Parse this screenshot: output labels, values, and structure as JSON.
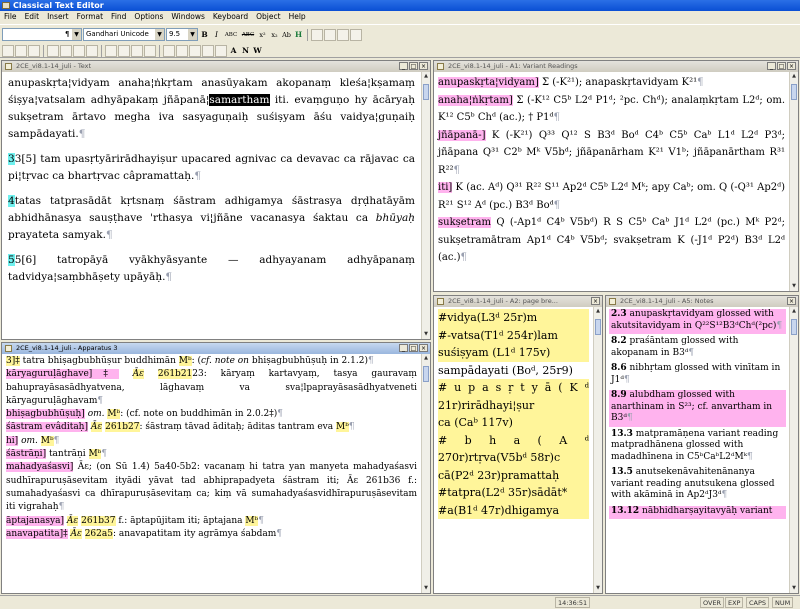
{
  "app": {
    "title": "Classical Text Editor"
  },
  "menu": [
    "File",
    "Edit",
    "Insert",
    "Format",
    "Find",
    "Options",
    "Windows",
    "Keyboard",
    "Object",
    "Help"
  ],
  "toolbar": {
    "style_value": "¶",
    "font_value": "Gandhari Unicode",
    "size_value": "9.5",
    "format_buttons": [
      "B",
      "I",
      "ABC",
      "ABC",
      "x²",
      "x₂",
      "Ab",
      "H"
    ],
    "r2_buttons": [
      "A",
      "N",
      "W"
    ]
  },
  "windows": {
    "text": {
      "title": "2CE_vi8.1-14_juli - Text"
    },
    "apparatus": {
      "title": "2CE_vi8.1-14_juli - Apparatus 3"
    },
    "variants": {
      "title": "2CE_vi8.1-14_juli - A1: Variant Readings"
    },
    "pagebreaks": {
      "title": "2CE_vi8.1-14_juli - A2: page bre..."
    },
    "notes": {
      "title": "2CE_vi8.1-14_juli - A5: Notes"
    }
  },
  "text": {
    "p1_a": "anupaskṛta¦vidyam  anaha¦ṅkṛtam  anasūyakam  akopanaṃ  kleśa¦kṣamaṃ  śiṣya¦vatsalam  adhyāpakaṃ  jñāpanā¦",
    "p1_sel": "samartham",
    "p1_b": "  iti.  evaṃguṇo  hy  ācāryaḥ  sukṣetram  ārtavo  megha  iva  sasyaguṇaiḥ  suśiṣyam  āśu  vaidya¦guṇaiḥ  sampādayati.",
    "p2_num": "3",
    "p2_label": "3[5]",
    "p2_text": " tam  upasṛtyārirādhayiṣur  upacared  agnivac  ca  devavac  ca  rājavac  ca  pi¦tṛvac  ca  bhartṛvac  câpramattaḥ.",
    "p3_num": "4",
    "p3_text": "tatas  tatprasādāt  kṛtsnaṃ  śāstram  adhigamya  śāstrasya  dṛḍhatāyām  abhidhānasya  sauṣṭhave  'rthasya  vi¦jñāne  vacanasya  śaktau  ca  ",
    "p3_it": "bhūyaḥ",
    "p3_end": "  prayateta  samyak.",
    "p4_num": "5",
    "p4_label": "5[6]",
    "p4_text": "  tatropāyā  vyākhyāsyante  —  adhyayanam  adhyāpanaṃ  tadvidya¦saṃbhāṣety  upāyāḥ."
  },
  "apparatus": {
    "e1_lem": "3]‡",
    "e1_a": " tatra  bhiṣagbubhūṣur  buddhimān  ",
    "e1_sig": "Mᵇ",
    "e1_b": ":  (",
    "e1_it": "cf. note on",
    "e1_c": " bhiṣagbubhūṣuḥ  in  2.1.2)",
    "e2_lem": "kāryaguruḷāghave]‡",
    "e2_sig": "Āɛ",
    "e2_loc": "261b21",
    "e2_text": "23:  kāryaṃ  kartavyaṃ,  tasya  gauravaṃ  bahuprayāsasādhyatvena,  lāghavaṃ  va  sva¦lpaprayāsasādhyatveneti  kāryaguruḷāghavam",
    "e3_lem": "bhiṣagbubhūṣuḥ]",
    "e3_it": "om.",
    "e3_sig": "Mᵇ",
    "e3_text": ":  (cf. note on buddhimān  in  2.0.2‡)",
    "e4_lem": "śāstram evâditaḥ]",
    "e4_sig": "Āɛ",
    "e4_loc": "261b27",
    "e4_text": ":  śāstraṃ  tāvad  āditaḥ;  āditas  tantram  eva  ",
    "e4_sig2": "Mᵇ",
    "e5_lem": "hi]",
    "e5_it": "om.",
    "e5_sig": "Mᵇ",
    "e6_lem": "śāstrāṇi]",
    "e6_text": " tantrāṇi  ",
    "e6_sig": "Mᵇ",
    "e7_lem": "mahadyaśasvi]",
    "e7_text": "  Āɛ;  (on  Sū  1.4)  5a40-5b2:  vacanaṃ  hi  tatra  yan  manyeta  mahadyaśasvi  sudhīrapuruṣāsevitam  ityādi  yāvat  tad  abhiprapadyeta  śāstram  iti;  Āɛ  261b36  f.:  sumahadyaśasvi  ca  dhīrapuruṣāsevitaṃ  ca;  kiṃ  vā  sumahadyaśasvidhīrapuruṣāsevitam  iti  vigrahaḥ",
    "e8_lem": "āptajanasya]",
    "e8_sig": "Āɛ",
    "e8_loc": "261b37",
    "e8_text": "  f.:  āptapūjitam  iti;  āptajana  ",
    "e8_sig2": "Mᵇ",
    "e9_lem": "anavapatita]‡",
    "e9_sig": "Āɛ",
    "e9_loc": "262a5",
    "e9_text": ":  anavapatitam  ity  agrāmya  śabdam"
  },
  "variants": {
    "v1_lem": "anupaskṛta¦vidyam]",
    "v1_text": "  Σ (-K²¹);  anapaskṛtavidyam  K²¹",
    "v2_lem": "anaha¦ṅkṛtam]",
    "v2_text": "  Σ (-K¹² C5ᵇ L2ᵈ P1ᵈ;  ²pc.  Chᵈ);  analaṃkṛtam  L2ᵈ;  om.  K¹² C5ᵇ Chᵈ (ac.);  † P1ᵈ",
    "v3_lem": "jñāpanā-]",
    "v3_text": "  K (-K²¹) Q³³ Q¹² S B3ᵈ Boᵈ C4ᵇ C5ᵇ Caᵇ L1ᵈ L2ᵈ P3ᵈ;  jñāpana  Q³¹ C2ᵇ Mᵏ V5bᵈ;  jñāpanārham  K²¹ V1ᵇ;  jñāpanārtham  R³¹ R²²",
    "v4_lem": "iti]",
    "v4_text": "  K (ac.  Aᵈ) Q³¹ R²² S¹¹ Ap2ᵈ C5ᵇ L2ᵈ Mᵏ;  apy  Caᵇ;  om.  Q (-Q³¹ Ap2ᵈ) R²¹ S¹² Aᵈ (pc.) B3ᵈ Boᵈ",
    "v5_lem": "sukṣetram",
    "v5_text": "  Q (-Ap1ᵈ C4ᵇ V5bᵈ) R S C5ᵇ Caᵇ J1ᵈ L2ᵈ (pc.) Mᵏ P2ᵈ;  sukṣetramātram  Ap1ᵈ C4ᵇ V5bᵈ;  svakṣetram  K (-J1ᵈ P2ᵈ) B3ᵈ L2ᵈ (ac.)"
  },
  "pagebreaks": {
    "l1": "#vidya(L3ᵈ 25r)m",
    "l2": "#-vatsa(T1ᵈ 254r)lam",
    "l3": "suśiṣyam (L1ᵈ 175v)",
    "l4": "sampādayati  (Boᵈ, 25r9)",
    "l5": "# u p a s ṛ t y ā ( K ᵈ 21r)rirādhayi¦ṣur",
    "l6": "ca (Caᵇ 117v)",
    "l7": "# b h a ( A ᵈ 270r)rtṛva(V5bᵈ 58r)c",
    "l8": "cā(P2ᵈ 23r)pramattaḥ",
    "l9": "#tatpra(L2ᵈ 35r)sādāt*",
    "l10": "#a(B1ᵈ 47r)dhigamya"
  },
  "notes": {
    "n1_num": "2.3",
    "n1_text": "  anupaskṛtavidyam  glossed  with  akutsitavidyam  in  Q²²S¹²B3ᵈChᵈ(²pc)",
    "n2_num": "8.2",
    "n2_text": "  praśāntam  glossed  with  akopanam  in  B3ᵈ",
    "n3_num": "8.6",
    "n3_text": "  nibhṛtam  glossed  with  vinītam  in  J1ᵈ",
    "n4_num": "8.9",
    "n4_text": "  alubdham  glossed  with  anarthinam  in  S²³;  cf.  anvartham  in  B3ᵈ",
    "n5_num": "13.3",
    "n5_text": "  matpramāṇena  variant  reading  matpradhānena  glossed  with  madadhīnena  in  C5ᵇCaᵇL2ᵈMᵏ",
    "n6_num": "13.5",
    "n6_text": "  anutsekenāvahitenānanya  variant  reading  anutsukena  glossed  with  akāminā  in  Ap2ᵈJ3ᵈ",
    "n7_num": "13.12",
    "n7_text": "  nābhidharṣayitavyāḥ  variant"
  },
  "status": {
    "time": "14:36:51",
    "ovr": "OVER",
    "ext": "EXP",
    "caps": "CAPS",
    "num": "NUM"
  },
  "colors": {
    "highlight_yellow": "#fff59a",
    "highlight_pink": "#ffb3ee",
    "highlight_cyan": "#6ff0ee"
  }
}
